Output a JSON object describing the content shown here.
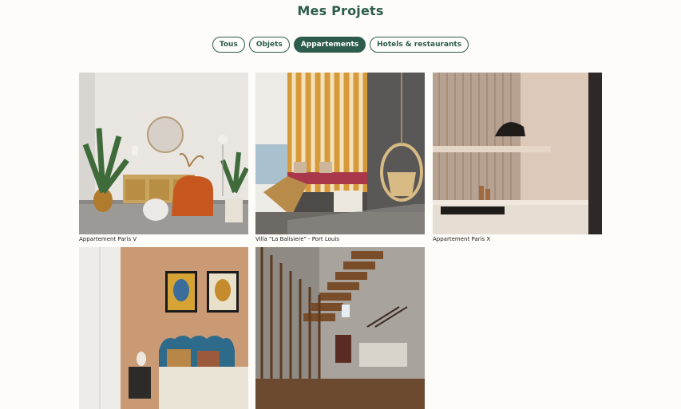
{
  "page": {
    "title": "Mes Projets"
  },
  "filters": [
    {
      "label": "Tous",
      "active": false
    },
    {
      "label": "Objets",
      "active": false
    },
    {
      "label": "Appartements",
      "active": true
    },
    {
      "label": "Hotels & restaurants",
      "active": false
    }
  ],
  "projects": [
    {
      "caption": "Appartement Paris V"
    },
    {
      "caption": "Villa \"La Balisiere\" - Port Louis"
    },
    {
      "caption": "Appartement Paris X"
    },
    {
      "caption": ""
    },
    {
      "caption": ""
    }
  ],
  "colors": {
    "accent": "#2d5c4c",
    "background": "#fdfcf8"
  }
}
